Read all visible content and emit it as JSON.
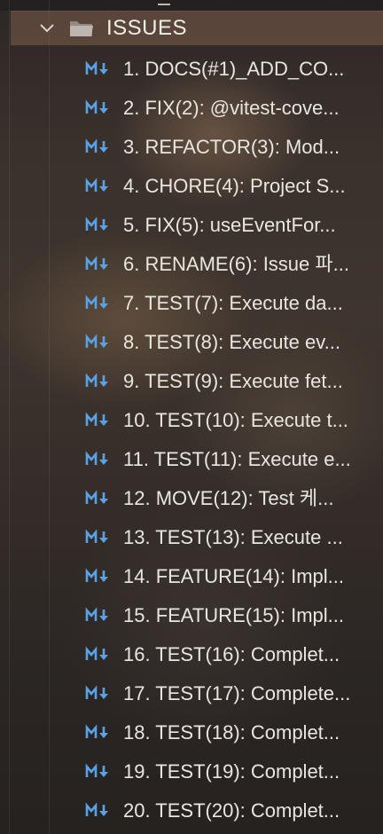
{
  "explorer": {
    "folder": {
      "name": "ISSUES",
      "expanded": true
    },
    "file_icon": "markdown-icon",
    "accent_color": "#5aa2e6",
    "files": [
      {
        "label": "1. DOCS(#1)_ADD_CO..."
      },
      {
        "label": "2. FIX(2): @vitest-cove..."
      },
      {
        "label": "3. REFACTOR(3): Mod..."
      },
      {
        "label": "4. CHORE(4): Project S..."
      },
      {
        "label": "5. FIX(5): useEventFor..."
      },
      {
        "label": "6. RENAME(6): Issue 파..."
      },
      {
        "label": "7. TEST(7): Execute da..."
      },
      {
        "label": "8. TEST(8): Execute ev..."
      },
      {
        "label": "9. TEST(9): Execute fet..."
      },
      {
        "label": "10. TEST(10): Execute t..."
      },
      {
        "label": "11. TEST(11): Execute e..."
      },
      {
        "label": "12. MOVE(12): Test 케..."
      },
      {
        "label": "13. TEST(13): Execute ..."
      },
      {
        "label": "14. FEATURE(14): Impl..."
      },
      {
        "label": "15. FEATURE(15): Impl..."
      },
      {
        "label": "16. TEST(16): Complet..."
      },
      {
        "label": "17. TEST(17): Complete..."
      },
      {
        "label": "18. TEST(18): Complet..."
      },
      {
        "label": "19. TEST(19): Complet..."
      },
      {
        "label": "20. TEST(20): Complet..."
      }
    ]
  }
}
